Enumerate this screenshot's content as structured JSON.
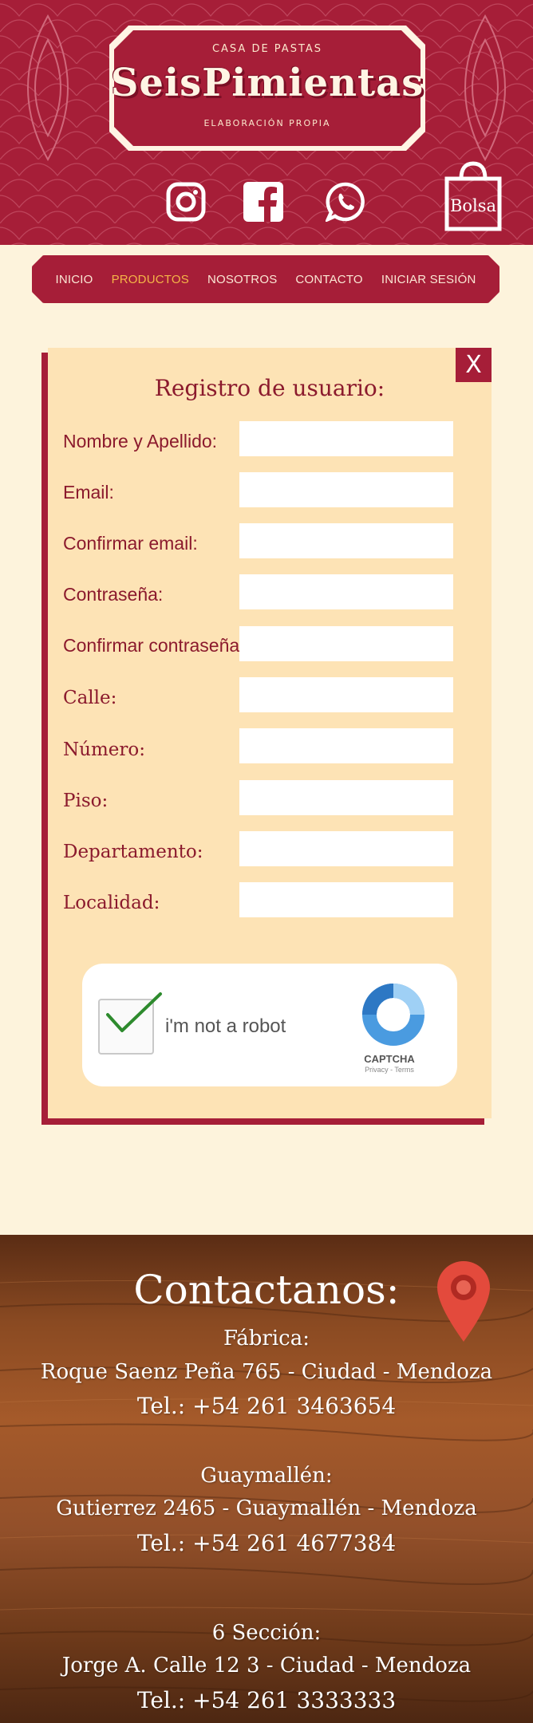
{
  "brand": {
    "top_text": "CASA DE PASTAS",
    "name": "SeisPimientas",
    "bottom_text": "ELABORACIÓN PROPIA"
  },
  "social": {
    "instagram_icon": "instagram-icon",
    "facebook_icon": "facebook-icon",
    "whatsapp_icon": "whatsapp-icon"
  },
  "cart": {
    "label": "Bolsa"
  },
  "nav": {
    "items": [
      {
        "label": "INICIO"
      },
      {
        "label": "PRODUCTOS"
      },
      {
        "label": "NOSOTROS"
      },
      {
        "label": "CONTACTO"
      },
      {
        "label": "INICIAR SESIÓN"
      }
    ]
  },
  "form": {
    "close_label": "X",
    "title": "Registro de usuario:",
    "fields": [
      {
        "label": "Nombre y Apellido:",
        "value": ""
      },
      {
        "label": "Email:",
        "value": ""
      },
      {
        "label": "Confirmar email:",
        "value": ""
      },
      {
        "label": "Contraseña:",
        "value": ""
      },
      {
        "label": "Confirmar contraseña:",
        "value": ""
      },
      {
        "label": "Calle:",
        "value": ""
      },
      {
        "label": "Número:",
        "value": ""
      },
      {
        "label": "Piso:",
        "value": ""
      },
      {
        "label": "Departamento:",
        "value": ""
      },
      {
        "label": "Localidad:",
        "value": ""
      }
    ],
    "captcha": {
      "text": "i'm not a robot",
      "brand": "CAPTCHA",
      "sub": "Privacy - Terms",
      "checked": true
    }
  },
  "footer": {
    "title": "Contactanos:",
    "locations": [
      {
        "name": "Fábrica:",
        "address": "Roque Saenz Peña 765 - Ciudad - Mendoza",
        "phone": "Tel.: +54 261 3463654"
      },
      {
        "name": "Guaymallén:",
        "address": "Gutierrez 2465 - Guaymallén - Mendoza",
        "phone": "Tel.: +54 261 4677384"
      },
      {
        "name": "6 Sección:",
        "address": "Jorge A. Calle 12 3 - Ciudad - Mendoza",
        "phone": "Tel.: +54 261 3333333"
      }
    ]
  },
  "colors": {
    "brand_red": "#a61e38",
    "cream": "#fdf3dc",
    "card": "#fde3b5",
    "accent_gold": "#f5b547"
  }
}
